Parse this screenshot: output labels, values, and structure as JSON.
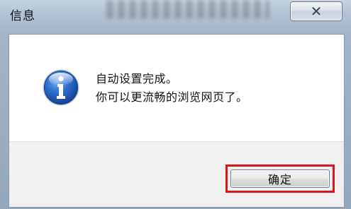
{
  "window": {
    "title": "信息",
    "close_label": "✕"
  },
  "dialog": {
    "icon": "info-icon",
    "message_line1": "自动设置完成。",
    "message_line2": "你可以更流畅的浏览网页了。",
    "ok_label": "确定"
  },
  "colors": {
    "highlight": "#e0141c",
    "icon_blue": "#1f5fb8"
  }
}
